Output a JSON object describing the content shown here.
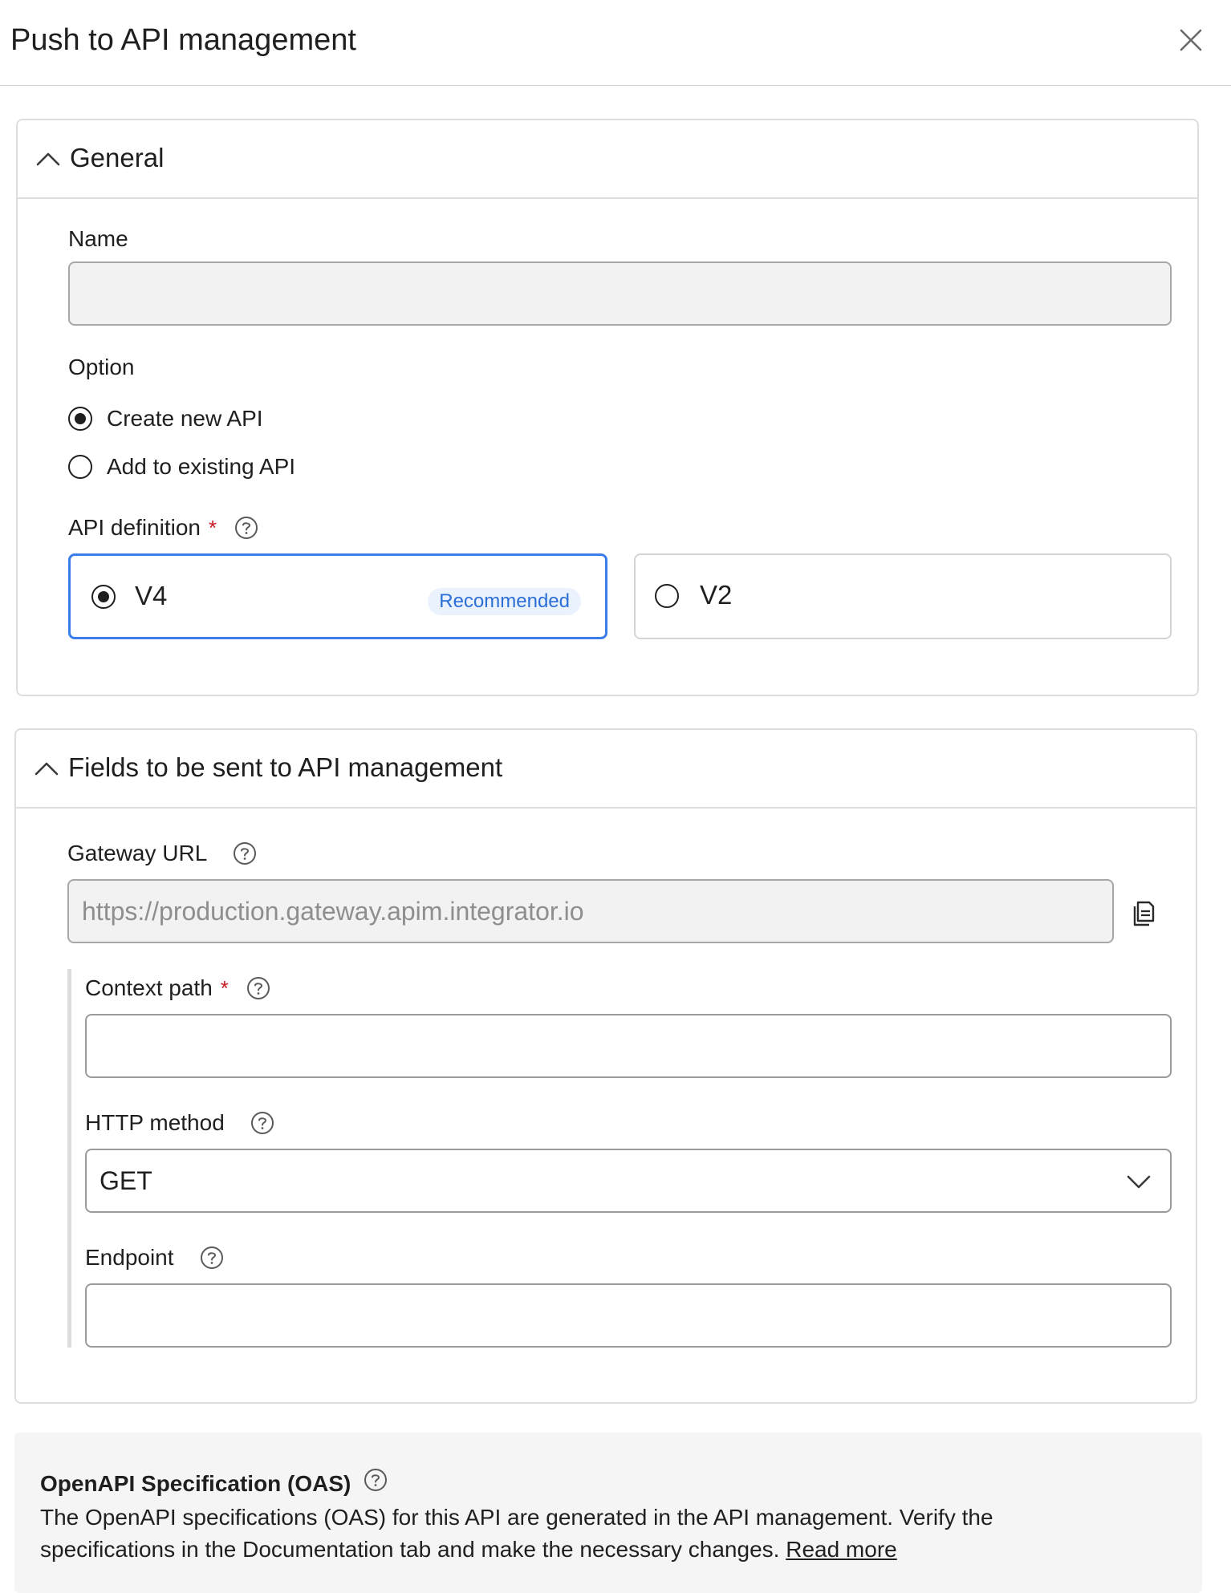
{
  "dialog": {
    "title": "Push to API management"
  },
  "general": {
    "title": "General",
    "name_label": "Name",
    "name_value": "",
    "option_label": "Option",
    "options": [
      {
        "label": "Create new API",
        "selected": true
      },
      {
        "label": "Add to existing API",
        "selected": false
      }
    ],
    "api_definition_label": "API definition",
    "required_mark": "*",
    "definitions": [
      {
        "label": "V4",
        "badge": "Recommended",
        "selected": true
      },
      {
        "label": "V2",
        "selected": false
      }
    ]
  },
  "fields": {
    "title": "Fields to be sent to API management",
    "gateway_url_label": "Gateway URL",
    "gateway_url_value": "https://production.gateway.apim.integrator.io",
    "context_path_label": "Context path",
    "context_path_value": "",
    "http_method_label": "HTTP method",
    "http_method_value": "GET",
    "endpoint_label": "Endpoint",
    "endpoint_value": ""
  },
  "oas": {
    "title": "OpenAPI Specification (OAS)",
    "line1": "The OpenAPI specifications (OAS) for this API are generated in the API management. Verify the",
    "line2": "specifications in the Documentation tab and make the necessary changes.",
    "read_more": "Read more"
  },
  "icons": {
    "close": "close-icon",
    "collapse": "chevron-up-icon",
    "help": "help-circle-icon",
    "copy": "copy-icon",
    "dropdown": "chevron-down-icon"
  },
  "colors": {
    "accent": "#3b7de9",
    "badge_bg": "#eaf2fd",
    "badge_text": "#2b6fd6",
    "required": "#c81d25"
  }
}
